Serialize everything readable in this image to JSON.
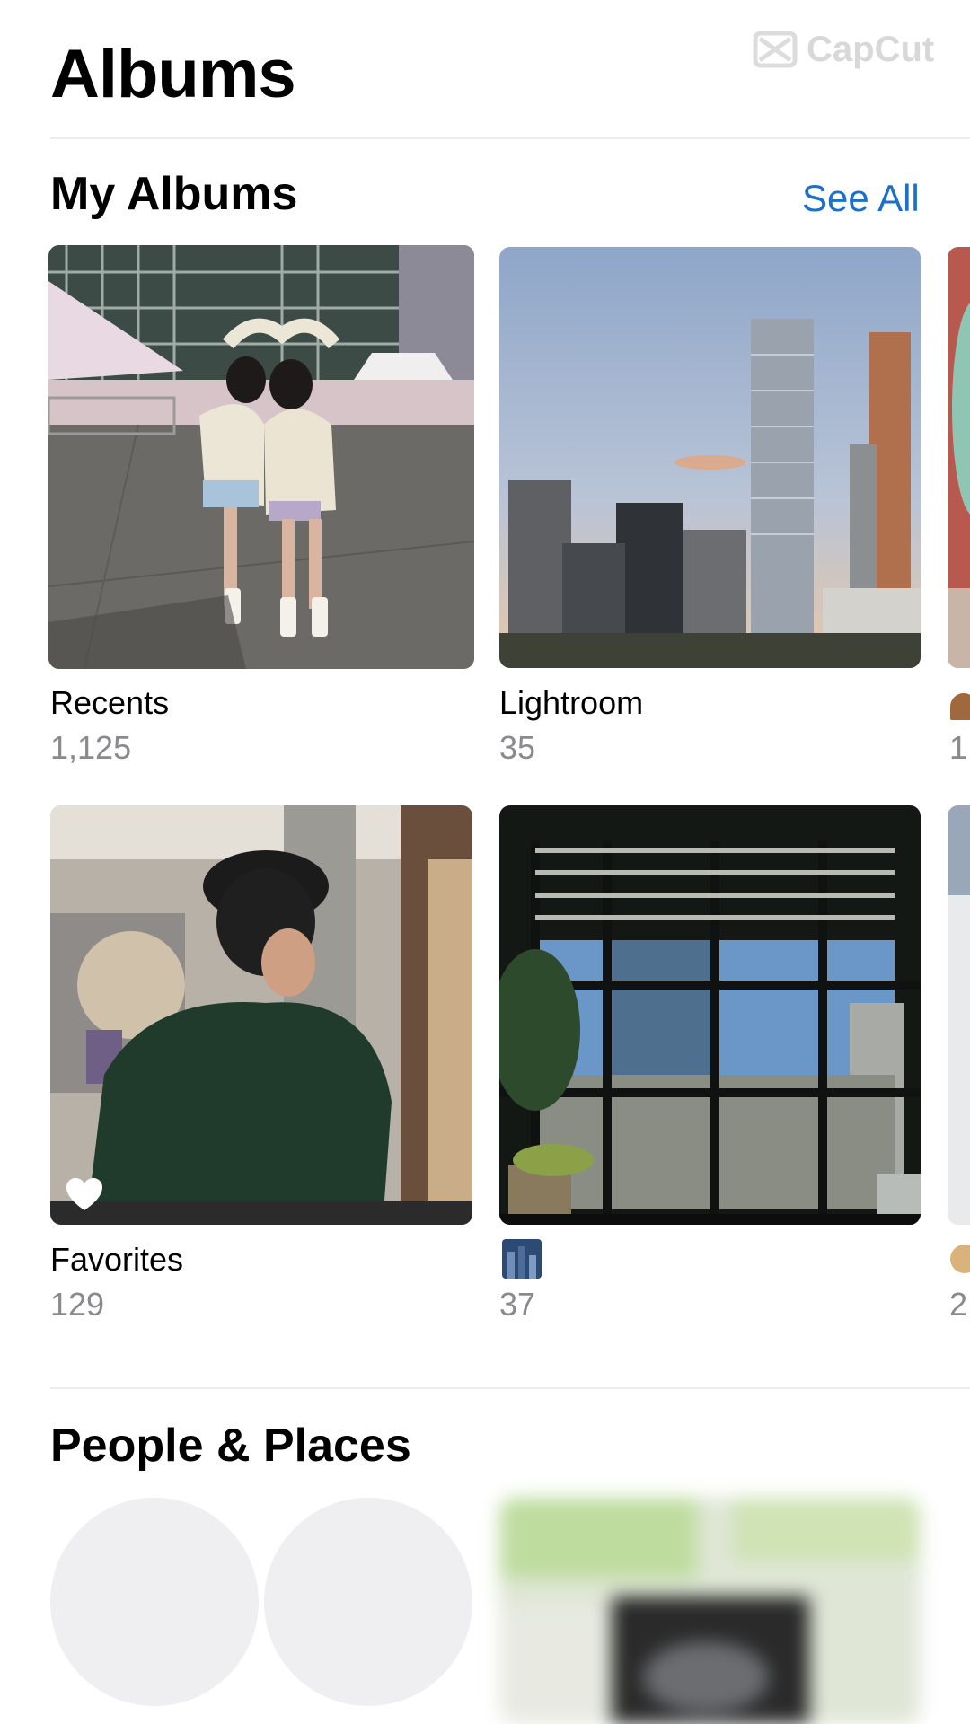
{
  "header": {
    "title": "Albums",
    "watermark": "CapCut"
  },
  "my_albums": {
    "title": "My Albums",
    "see_all": "See All",
    "albums": [
      {
        "name": "Recents",
        "count": "1,125"
      },
      {
        "name": "Lightroom",
        "count": "35"
      },
      {
        "name": "Favorites",
        "count": "129"
      },
      {
        "name": "",
        "count": "37"
      }
    ],
    "partial_counts": [
      "1",
      "2"
    ]
  },
  "people_places": {
    "title": "People & Places"
  },
  "colors": {
    "accent": "#1e6fc9",
    "secondary_text": "#8a8a8e"
  }
}
